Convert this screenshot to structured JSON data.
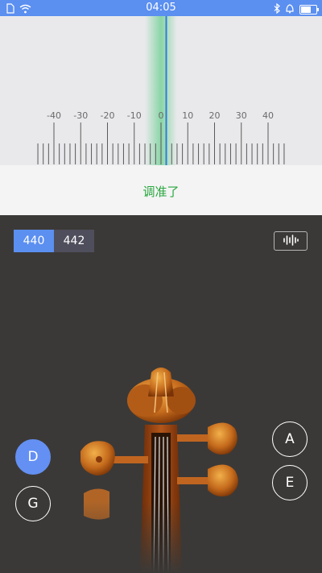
{
  "status_bar": {
    "time": "04:05"
  },
  "tuner": {
    "scale_labels": [
      "-40",
      "-30",
      "-20",
      "-10",
      "0",
      "10",
      "20",
      "30",
      "40"
    ],
    "indicator_color": "#2e7fd6",
    "band_color": "#7ed39e"
  },
  "status": {
    "text": "调准了",
    "color": "#29a63f"
  },
  "reference": {
    "options": [
      "440",
      "442"
    ],
    "selected": "440"
  },
  "strings": {
    "left": [
      {
        "label": "D",
        "selected": true
      },
      {
        "label": "G",
        "selected": false
      }
    ],
    "right": [
      {
        "label": "A",
        "selected": false
      },
      {
        "label": "E",
        "selected": false
      }
    ]
  },
  "colors": {
    "accent": "#5b8ff0",
    "panel_bg": "#3b3937",
    "tuner_bg": "#e9e9ec"
  }
}
